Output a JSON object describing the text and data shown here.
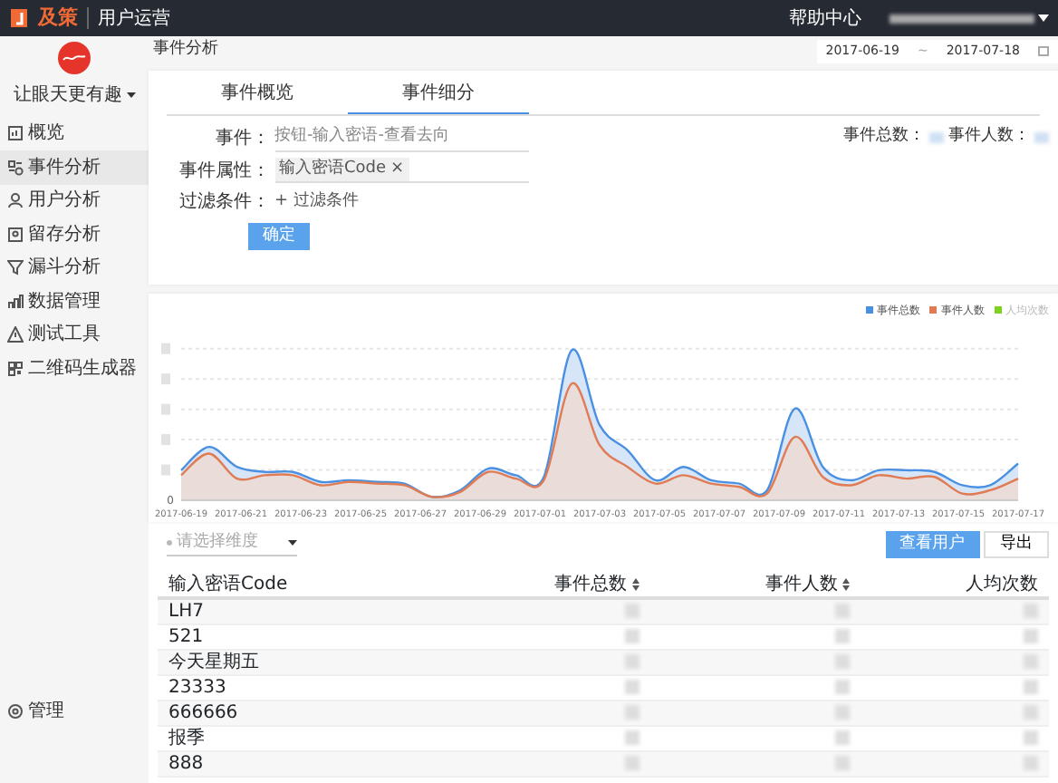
{
  "topbar": {
    "brand": "及策",
    "product": "用户运营",
    "help": "帮助中心"
  },
  "sidebar": {
    "company": "让眼天更有趣",
    "items": [
      {
        "label": "概览",
        "selected": false
      },
      {
        "label": "事件分析",
        "selected": true
      },
      {
        "label": "用户分析",
        "selected": false
      },
      {
        "label": "留存分析",
        "selected": false
      },
      {
        "label": "漏斗分析",
        "selected": false
      },
      {
        "label": "数据管理",
        "selected": false
      },
      {
        "label": "测试工具",
        "selected": false
      },
      {
        "label": "二维码生成器",
        "selected": false
      }
    ],
    "footer": {
      "label": "管理"
    }
  },
  "breadcrumb": "事件分析",
  "date_range": {
    "start": "2017-06-19",
    "separator": "~",
    "end": "2017-07-18"
  },
  "tabs": [
    {
      "label": "事件概览",
      "selected": false
    },
    {
      "label": "事件细分",
      "selected": true
    }
  ],
  "form": {
    "event_label": "事件：",
    "event_value": "按钮-输入密语-查看去向",
    "attr_label": "事件属性：",
    "attr_tag": "输入密语Code",
    "attr_remove": "×",
    "filter_label": "过滤条件：",
    "filter_add": "+ 过滤条件",
    "confirm": "确定"
  },
  "totals": {
    "total_label": "事件总数：",
    "people_label": "事件人数："
  },
  "chart": {
    "legend": [
      {
        "label": "事件总数",
        "color": "#4a90e2",
        "on": true
      },
      {
        "label": "事件人数",
        "color": "#e07b53",
        "on": true
      },
      {
        "label": "人均次数",
        "color": "#7ed321",
        "on": false
      }
    ],
    "y_origin": "0",
    "x_labels": [
      "2017-06-19",
      "2017-06-21",
      "2017-06-23",
      "2017-06-25",
      "2017-06-27",
      "2017-06-29",
      "2017-07-01",
      "2017-07-03",
      "2017-07-05",
      "2017-07-07",
      "2017-07-09",
      "2017-07-11",
      "2017-07-13",
      "2017-07-15",
      "2017-07-17"
    ]
  },
  "table_toolbar": {
    "dimension_placeholder": "请选择维度",
    "view_users": "查看用户",
    "export": "导出"
  },
  "table": {
    "columns": [
      {
        "label": "输入密语Code",
        "sortable": false
      },
      {
        "label": "事件总数",
        "sortable": true
      },
      {
        "label": "事件人数",
        "sortable": true
      },
      {
        "label": "人均次数",
        "sortable": false
      }
    ],
    "rows": [
      {
        "code": "LH7"
      },
      {
        "code": "521"
      },
      {
        "code": "今天星期五"
      },
      {
        "code": "23333"
      },
      {
        "code": "666666"
      },
      {
        "code": "报季"
      },
      {
        "code": "888"
      }
    ]
  }
}
